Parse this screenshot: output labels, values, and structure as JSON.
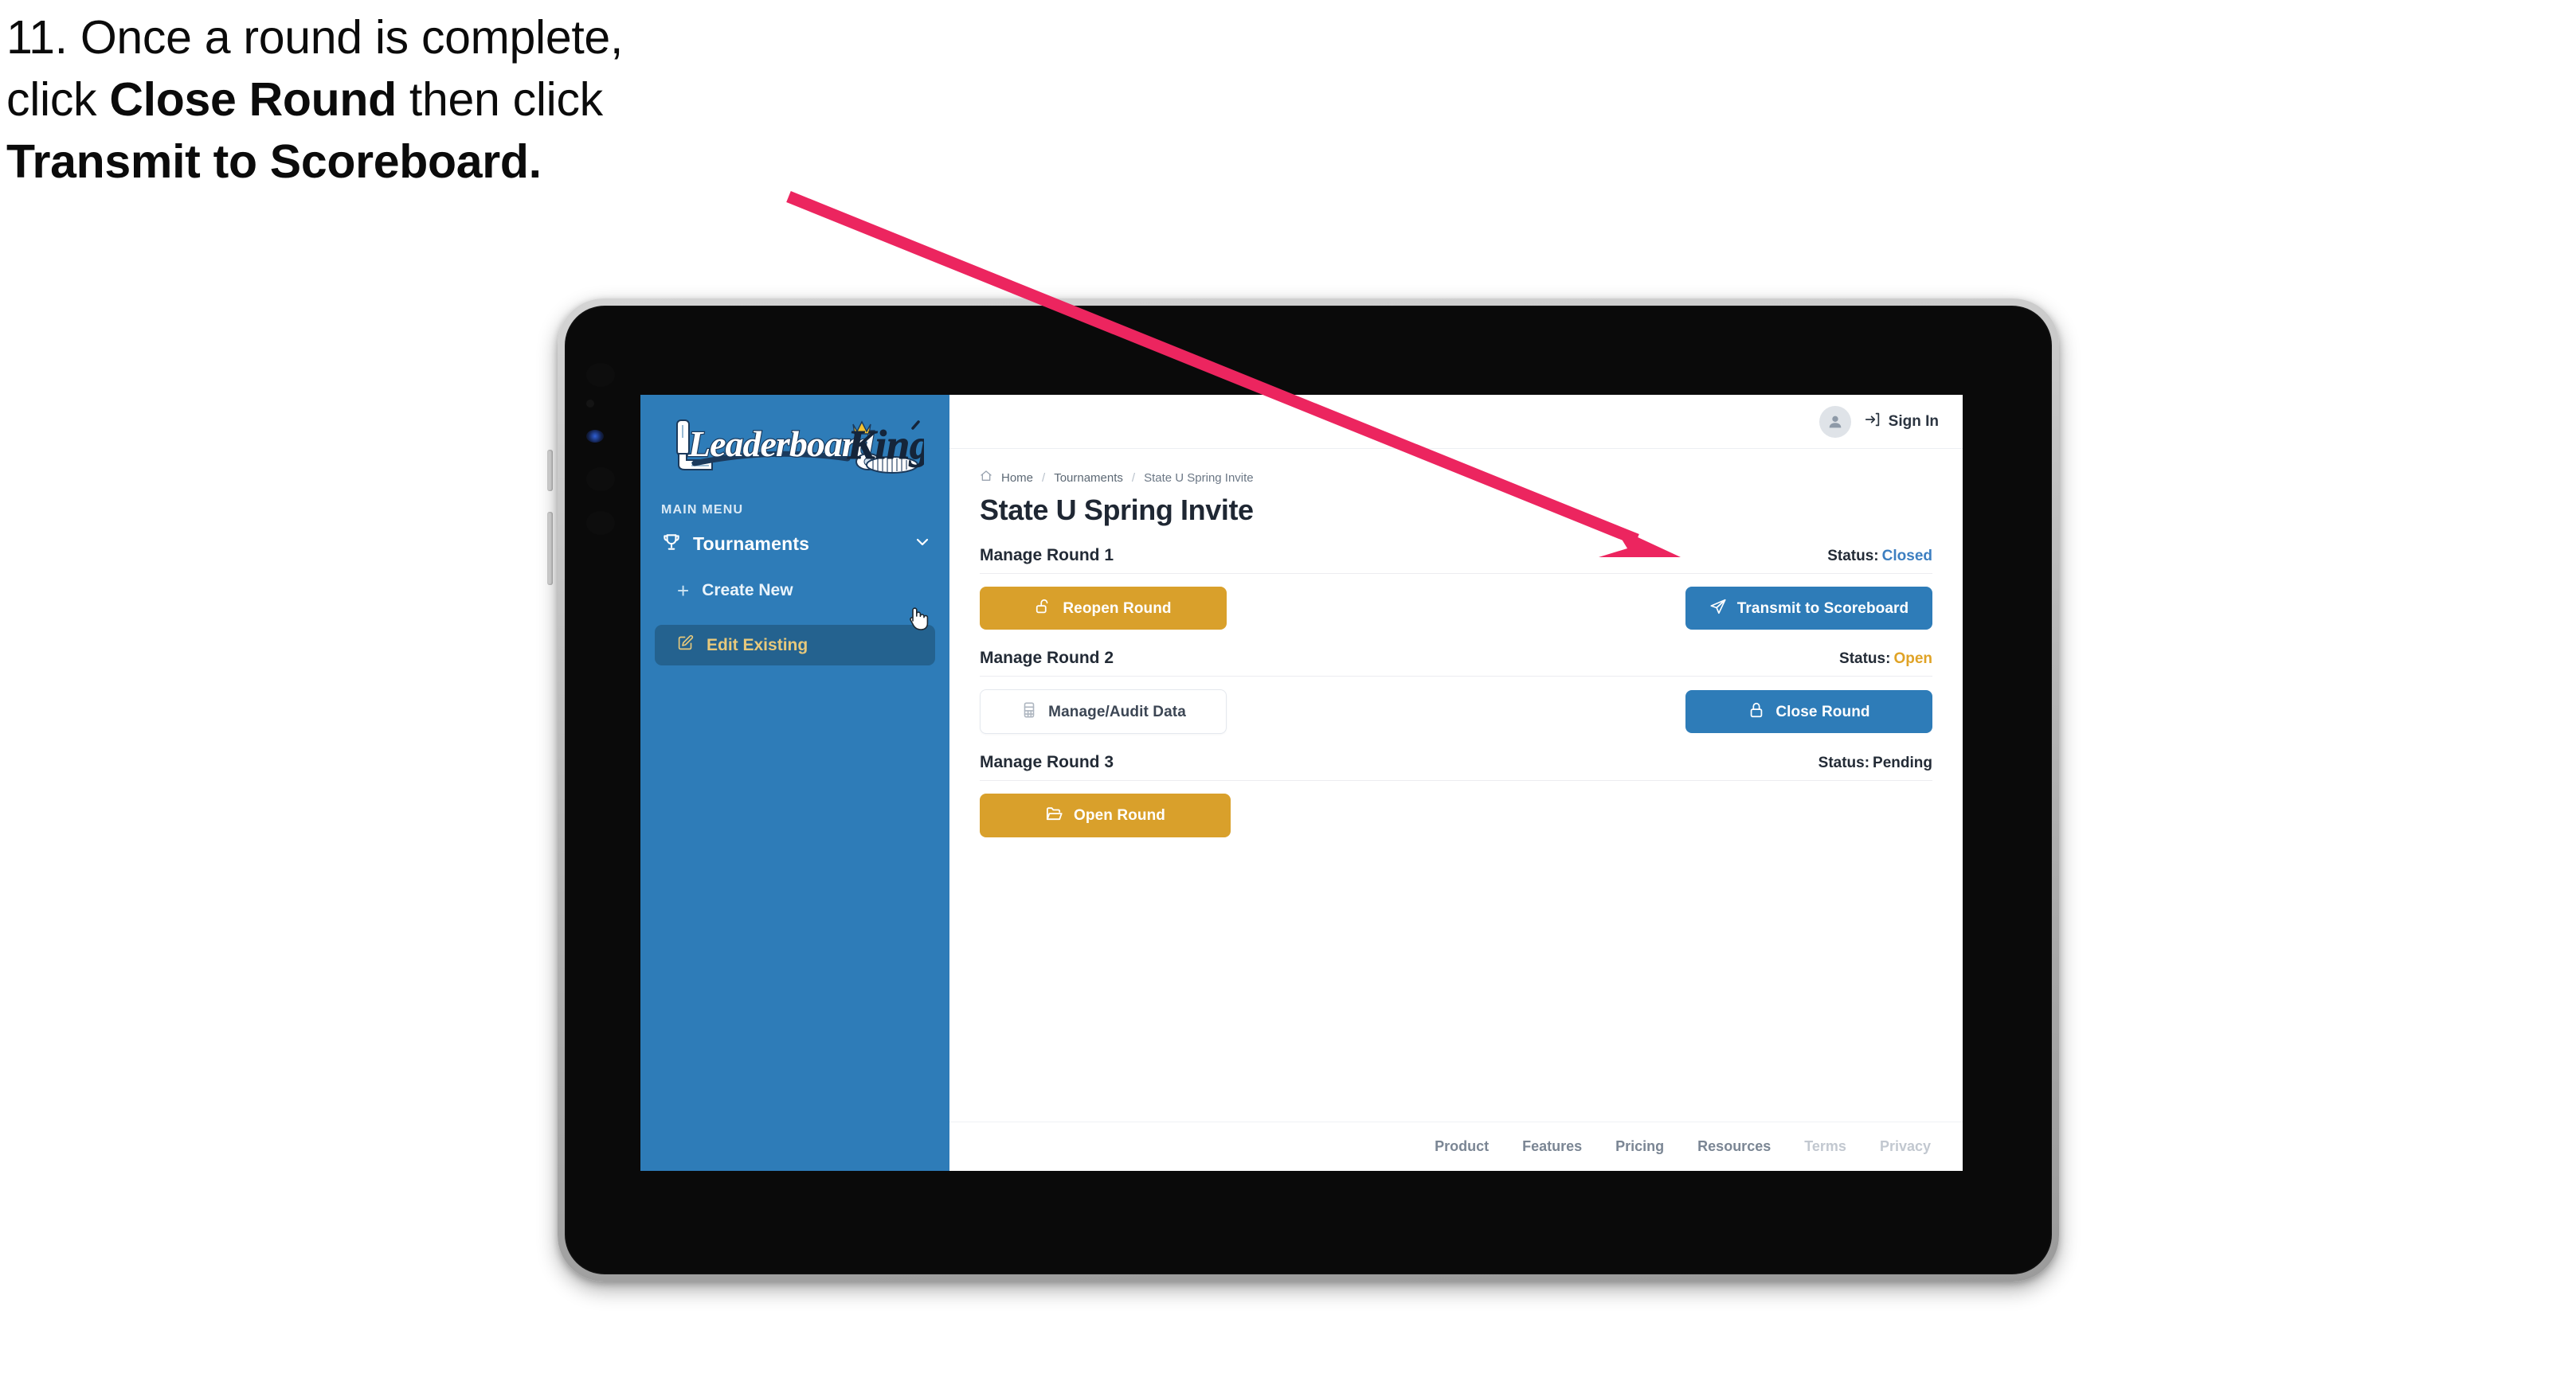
{
  "instruction": {
    "line1": "11. Once a round is complete,",
    "line2_pre": "click ",
    "line2_bold": "Close Round",
    "line2_post": " then click",
    "line3_bold": "Transmit to Scoreboard."
  },
  "brand": {
    "logo_text_primary": "Leaderboard",
    "logo_text_secondary": "King",
    "logo_icon": "golf-putter-icon",
    "crown_icon": "crown-icon",
    "golfball_icon": "golf-ball-icon"
  },
  "sidebar": {
    "section_label": "MAIN MENU",
    "nav": {
      "label": "Tournaments",
      "icon": "trophy-icon",
      "chevron": "chevron-down-icon"
    },
    "items": [
      {
        "label": "Create New",
        "icon": "plus-icon",
        "active": false
      },
      {
        "label": "Edit Existing",
        "icon": "edit-pencil-icon",
        "active": true
      }
    ],
    "bg_color": "#2e7cb8",
    "active_bg_color": "#24628f",
    "active_text_color": "#e7c97c"
  },
  "topbar": {
    "avatar_icon": "user-avatar-icon",
    "signin_icon": "sign-in-arrow-icon",
    "signin_label": "Sign In"
  },
  "breadcrumb": {
    "home_icon": "home-icon",
    "items": [
      "Home",
      "Tournaments",
      "State U Spring Invite"
    ],
    "separator": "/"
  },
  "page": {
    "title": "State U Spring Invite"
  },
  "rounds": [
    {
      "title": "Manage Round 1",
      "status_label": "Status:",
      "status_value": "Closed",
      "status_class": "closed",
      "status_color": "#3d7fc1",
      "left_button": {
        "label": "Reopen Round",
        "icon": "unlock-icon",
        "style": "gold",
        "width_class": "w-reopen"
      },
      "right_button": {
        "label": "Transmit to Scoreboard",
        "icon": "paper-plane-icon",
        "style": "blue",
        "width_class": "w-transmit"
      }
    },
    {
      "title": "Manage Round 2",
      "status_label": "Status:",
      "status_value": "Open",
      "status_class": "open",
      "status_color": "#e0a326",
      "left_button": {
        "label": "Manage/Audit Data",
        "icon": "spreadsheet-icon",
        "style": "ghost",
        "width_class": "w-audit"
      },
      "right_button": {
        "label": "Close Round",
        "icon": "lock-icon",
        "style": "blue",
        "width_class": "w-close"
      }
    },
    {
      "title": "Manage Round 3",
      "status_label": "Status:",
      "status_value": "Pending",
      "status_class": "pending",
      "status_color": "#232b36",
      "left_button": {
        "label": "Open Round",
        "icon": "folder-open-icon",
        "style": "gold",
        "width_class": "w-open"
      },
      "right_button": null
    }
  ],
  "footer": {
    "links": [
      {
        "label": "Product",
        "dim": false
      },
      {
        "label": "Features",
        "dim": false
      },
      {
        "label": "Pricing",
        "dim": false
      },
      {
        "label": "Resources",
        "dim": false
      },
      {
        "label": "Terms",
        "dim": true
      },
      {
        "label": "Privacy",
        "dim": true
      }
    ]
  },
  "annotation": {
    "arrow_color": "#ec255f",
    "points_to": "Transmit to Scoreboard"
  },
  "cursor": {
    "icon": "hand-pointer-cursor"
  }
}
